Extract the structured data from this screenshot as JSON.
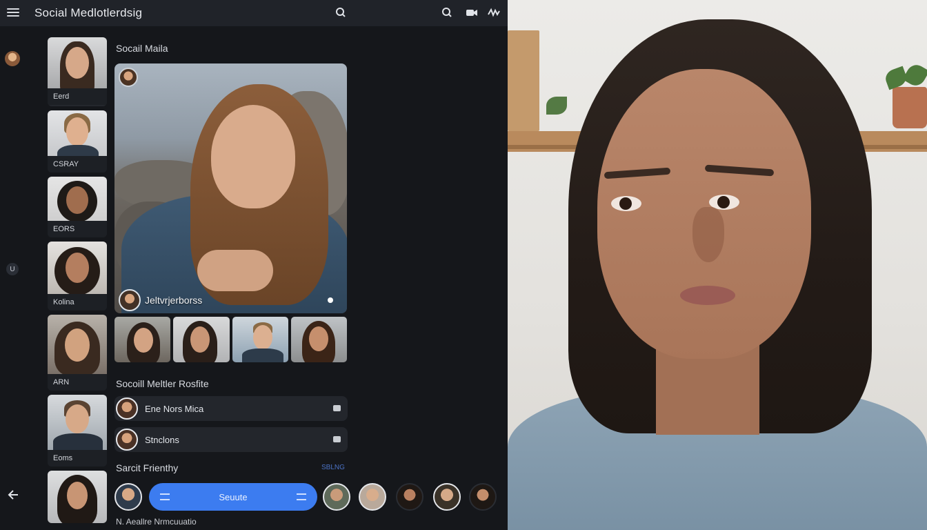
{
  "header": {
    "title": "Social Medlotlerdsig",
    "icons": [
      "menu-icon",
      "search-icon",
      "search-icon",
      "camera-icon",
      "activity-icon"
    ]
  },
  "sidebar": {
    "icons": [
      "avatar",
      "shield-icon",
      "back-arrow-icon"
    ],
    "badge": "U"
  },
  "stories": [
    {
      "label": "Eerd"
    },
    {
      "label": "CSRAY"
    },
    {
      "label": "EORS"
    },
    {
      "label": "Kolina"
    },
    {
      "label": "ARN"
    },
    {
      "label": "Eoms"
    },
    {
      "label": ""
    }
  ],
  "main": {
    "section_title": "Socail Maila",
    "feature": {
      "caption": "Jeltvrjerborss"
    },
    "profile_title": "Socoill Meltler Rosfite",
    "rows": [
      {
        "label": "Ene Nors Mica"
      },
      {
        "label": "Stnclons"
      }
    ],
    "friends_title": "Sarcit Frienthy",
    "friends_link": "SBLNG",
    "action_label": "Seuute",
    "footer_text": "N.  Aeallre Nrmcuuatio"
  },
  "colors": {
    "accent": "#3c7cf0",
    "panel": "#15171b",
    "topbar": "#202329"
  }
}
